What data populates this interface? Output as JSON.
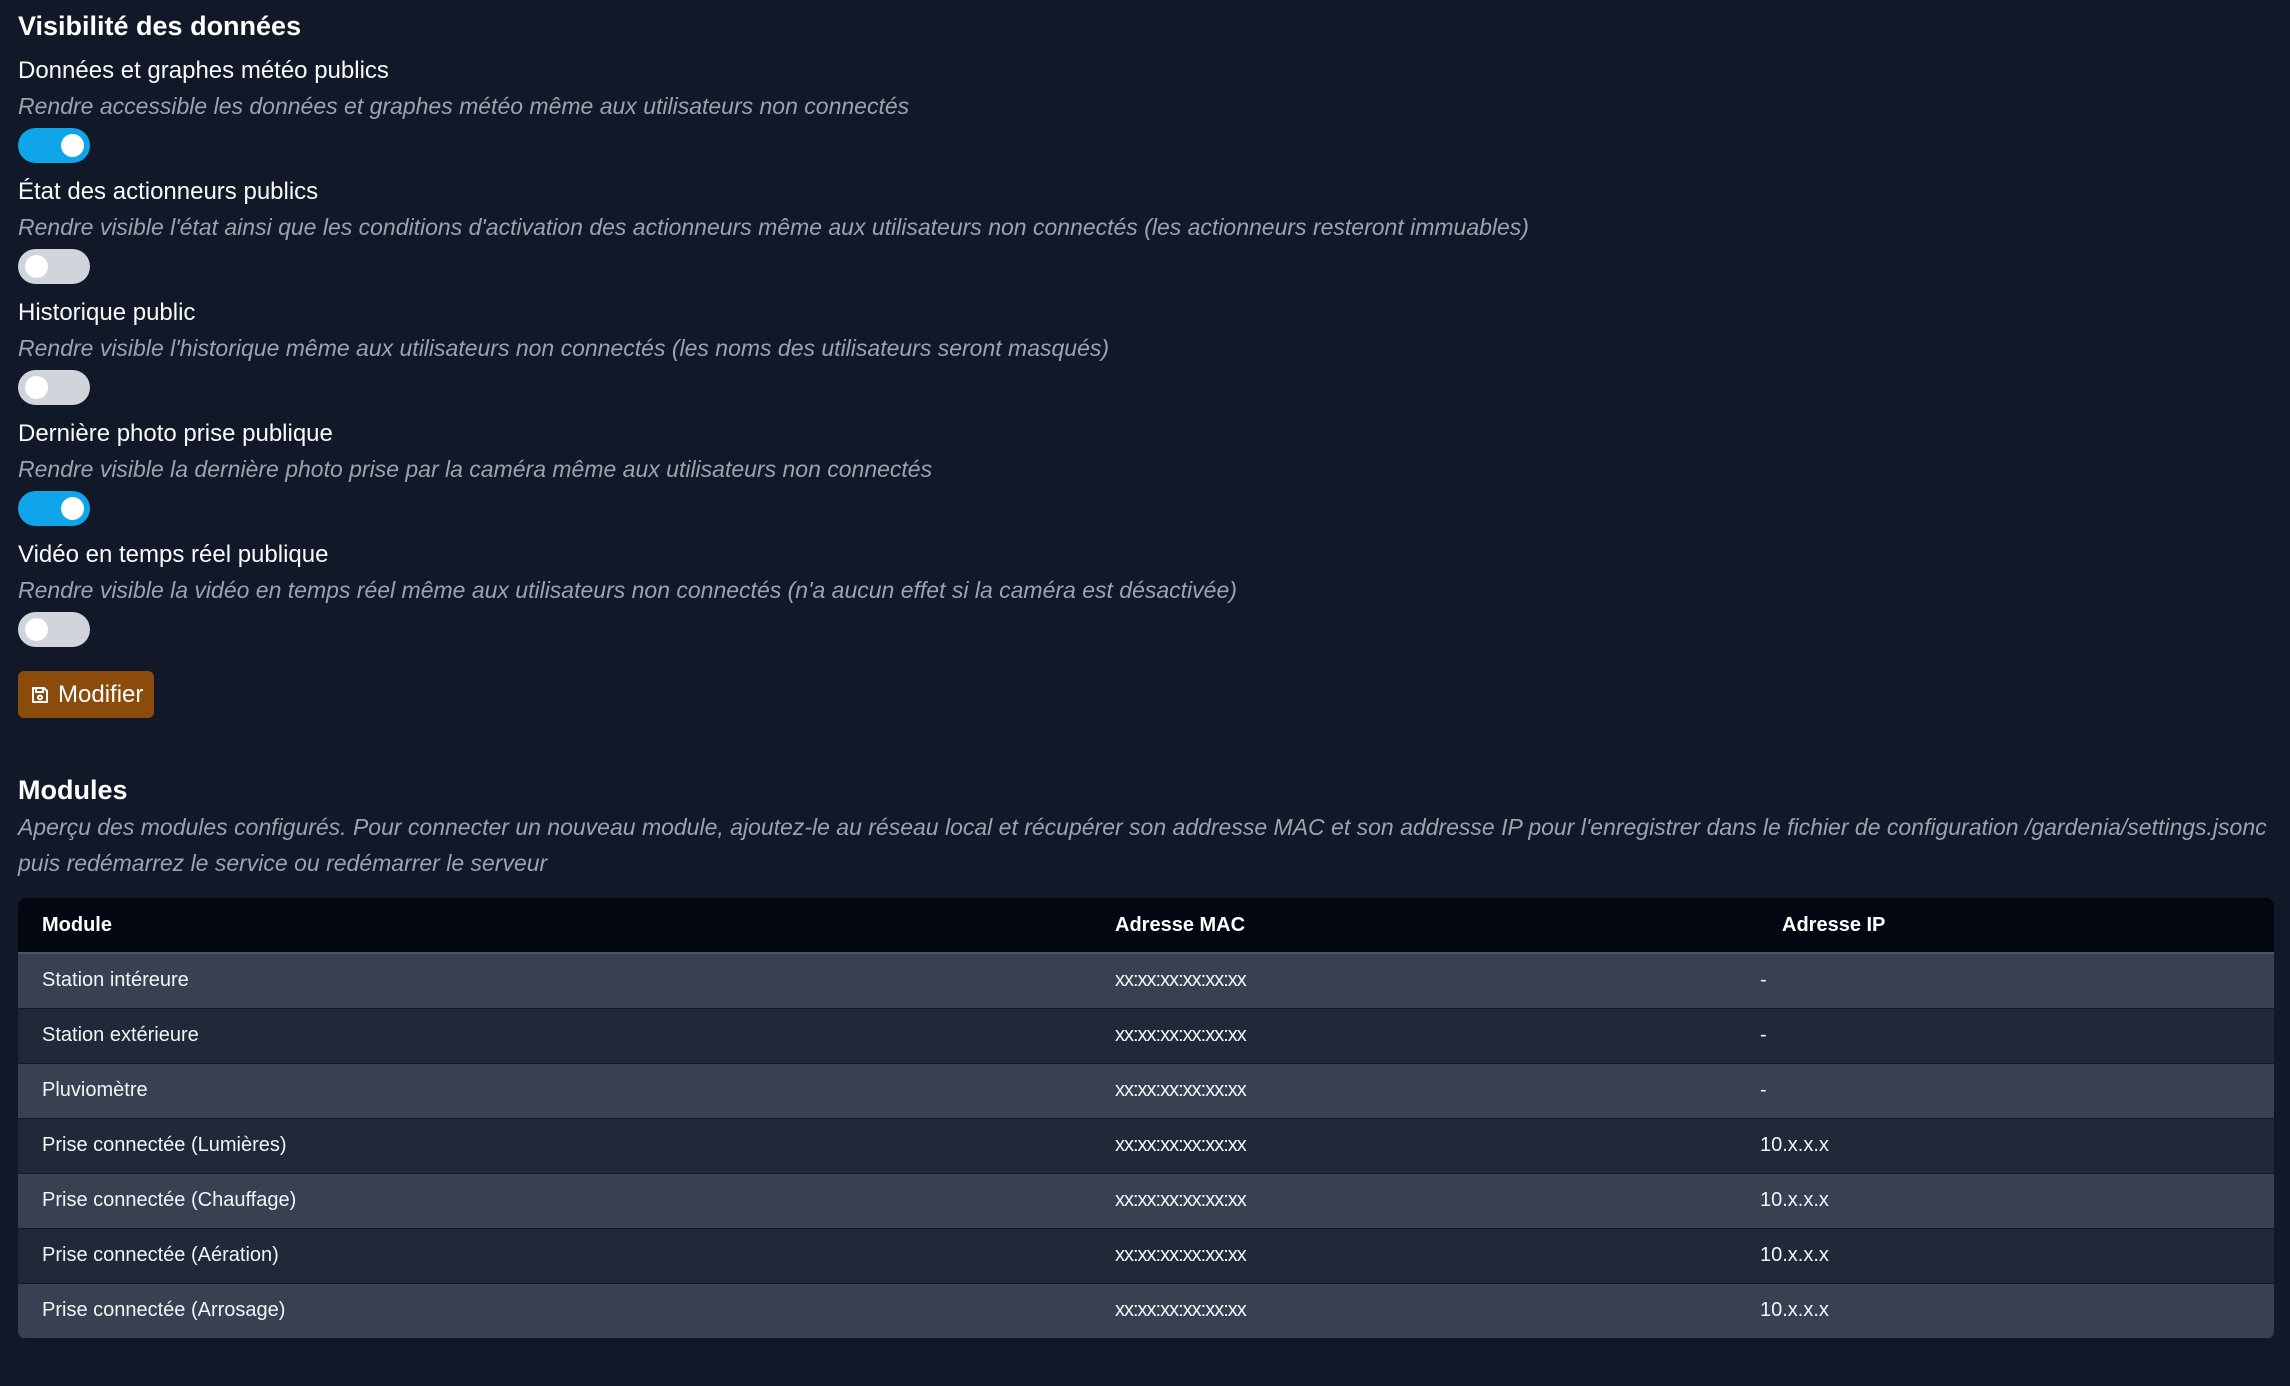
{
  "visibility": {
    "title": "Visibilité des données",
    "settings": [
      {
        "label": "Données et graphes météo publics",
        "description": "Rendre accessible les données et graphes météo même aux utilisateurs non connectés",
        "enabled": true
      },
      {
        "label": "État des actionneurs publics",
        "description": "Rendre visible l'état ainsi que les conditions d'activation des actionneurs même aux utilisateurs non connectés (les actionneurs resteront immuables)",
        "enabled": false
      },
      {
        "label": "Historique public",
        "description": "Rendre visible l'historique même aux utilisateurs non connectés (les noms des utilisateurs seront masqués)",
        "enabled": false
      },
      {
        "label": "Dernière photo prise publique",
        "description": "Rendre visible la dernière photo prise par la caméra même aux utilisateurs non connectés",
        "enabled": true
      },
      {
        "label": "Vidéo en temps réel publique",
        "description": "Rendre visible la vidéo en temps réel même aux utilisateurs non connectés (n'a aucun effet si la caméra est désactivée)",
        "enabled": false
      }
    ],
    "save_button": {
      "label": "Modifier",
      "icon": "save-icon"
    }
  },
  "modules": {
    "title": "Modules",
    "description": "Aperçu des modules configurés. Pour connecter un nouveau module, ajoutez-le au réseau local et récupérer son addresse MAC et son addresse IP pour l'enregistrer dans le fichier de configuration /gardenia/settings.jsonc puis redémarrez le service ou redémarrer le serveur",
    "columns": [
      "Module",
      "Adresse MAC",
      "Adresse IP"
    ],
    "rows": [
      {
        "module": "Station intéreure",
        "mac": "xx:xx:xx:xx:xx:xx",
        "ip": "-"
      },
      {
        "module": "Station extérieure",
        "mac": "xx:xx:xx:xx:xx:xx",
        "ip": "-"
      },
      {
        "module": "Pluviomètre",
        "mac": "xx:xx:xx:xx:xx:xx",
        "ip": "-"
      },
      {
        "module": "Prise connectée (Lumières)",
        "mac": "xx:xx:xx:xx:xx:xx",
        "ip": "10.x.x.x"
      },
      {
        "module": "Prise connectée (Chauffage)",
        "mac": "xx:xx:xx:xx:xx:xx",
        "ip": "10.x.x.x"
      },
      {
        "module": "Prise connectée (Aération)",
        "mac": "xx:xx:xx:xx:xx:xx",
        "ip": "10.x.x.x"
      },
      {
        "module": "Prise connectée (Arrosage)",
        "mac": "xx:xx:xx:xx:xx:xx",
        "ip": "10.x.x.x"
      }
    ]
  },
  "colors": {
    "background": "#111827",
    "toggle_on": "#0ea5e9",
    "toggle_off": "#d1d5db",
    "button": "#8a4b0b"
  }
}
